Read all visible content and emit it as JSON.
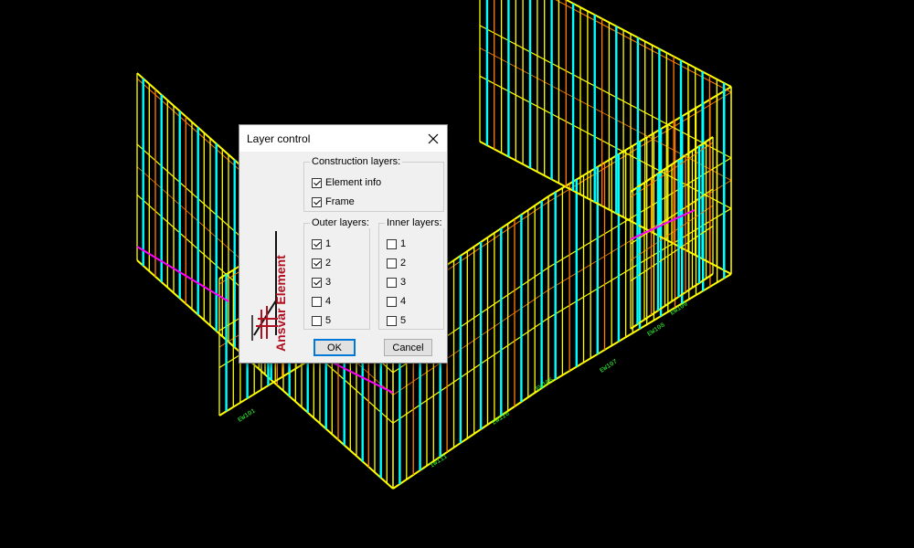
{
  "dialog": {
    "title": "Layer control",
    "construction": {
      "label": "Construction layers:",
      "items": [
        {
          "label": "Element info",
          "checked": true
        },
        {
          "label": "Frame",
          "checked": true
        }
      ]
    },
    "outer": {
      "label": "Outer layers:",
      "items": [
        {
          "label": "1",
          "checked": true
        },
        {
          "label": "2",
          "checked": true
        },
        {
          "label": "3",
          "checked": true
        },
        {
          "label": "4",
          "checked": false
        },
        {
          "label": "5",
          "checked": false
        }
      ]
    },
    "inner": {
      "label": "Inner layers:",
      "items": [
        {
          "label": "1",
          "checked": false
        },
        {
          "label": "2",
          "checked": false
        },
        {
          "label": "3",
          "checked": false
        },
        {
          "label": "4",
          "checked": false
        },
        {
          "label": "5",
          "checked": false
        }
      ]
    },
    "ok_label": "OK",
    "cancel_label": "Cancel",
    "logo_text": "Ansvar Element"
  },
  "drawing": {
    "element_labels": [
      "EW101",
      "IW111",
      "EW120",
      "EW106",
      "EW107",
      "EW108",
      "EW109"
    ]
  },
  "colors": {
    "stud_yellow": "#ffff00",
    "stud_cyan": "#00ffff",
    "member_orange": "#ff8000",
    "header_magenta": "#ff00ff",
    "label_green": "#33ff33",
    "logo_red": "#b01020"
  }
}
